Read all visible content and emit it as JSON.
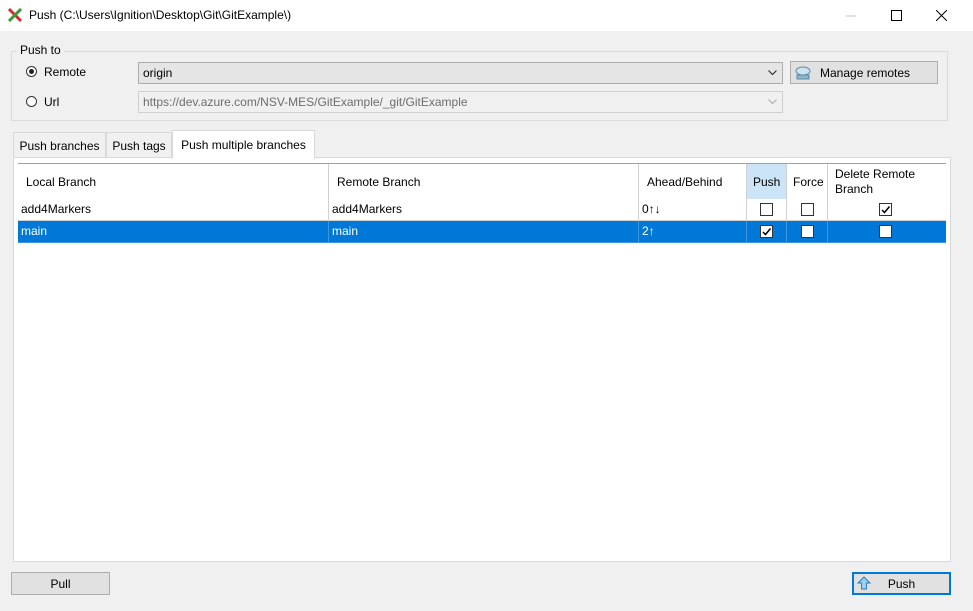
{
  "window": {
    "title": "Push (C:\\Users\\Ignition\\Desktop\\Git\\GitExample\\)"
  },
  "push_to": {
    "label": "Push to",
    "remote_option": "Remote",
    "url_option": "Url",
    "remote_selected": true,
    "remote_value": "origin",
    "url_value": "https://dev.azure.com/NSV-MES/GitExample/_git/GitExample",
    "manage_remotes_label": "Manage remotes"
  },
  "tabs": [
    "Push branches",
    "Push tags",
    "Push multiple branches"
  ],
  "active_tab": 2,
  "table": {
    "columns": [
      "Local Branch",
      "Remote Branch",
      "Ahead/Behind",
      "Push",
      "Force",
      "Delete Remote Branch"
    ],
    "rows": [
      {
        "local": "add4Markers",
        "remote": "add4Markers",
        "ahead_behind": "0↑↓",
        "push": false,
        "force": false,
        "delete_remote": true
      },
      {
        "local": "main",
        "remote": "main",
        "ahead_behind": "2↑",
        "push": true,
        "force": false,
        "delete_remote": false
      }
    ],
    "selected_row": 1
  },
  "buttons": {
    "pull": "Pull",
    "push": "Push"
  },
  "colors": {
    "selection": "#0078d7",
    "header_highlight": "#cce4f7"
  }
}
